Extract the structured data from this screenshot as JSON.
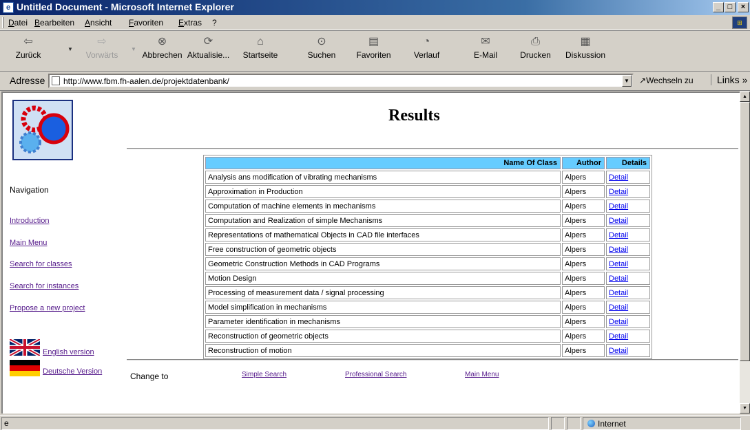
{
  "window": {
    "title": "Untitled Document - Microsoft Internet Explorer"
  },
  "menu": [
    "Datei",
    "Bearbeiten",
    "Ansicht",
    "Favoriten",
    "Extras",
    "?"
  ],
  "toolbar": {
    "back": "Zurück",
    "forward": "Vorwärts",
    "stop": "Abbrechen",
    "refresh": "Aktualisie...",
    "home": "Startseite",
    "search": "Suchen",
    "favorites": "Favoriten",
    "history": "Verlauf",
    "mail": "E-Mail",
    "print": "Drucken",
    "discuss": "Diskussion"
  },
  "address": {
    "label": "Adresse",
    "url": "http://www.fbm.fh-aalen.de/projektdatenbank/",
    "go": "Wechseln zu",
    "links": "Links »"
  },
  "page": {
    "title": "Results",
    "nav_heading": "Navigation",
    "nav": [
      "Introduction",
      "Main Menu",
      "Search for classes",
      "Search for instances",
      "Propose a new project"
    ],
    "english": "English version",
    "deutsch": "Deutsche Version",
    "change_to": "Change to",
    "footer_links": [
      "Simple Search",
      "Professional Search",
      "Main Menu"
    ]
  },
  "table": {
    "headers": [
      "Name Of Class",
      "Author",
      "Details"
    ],
    "rows": [
      {
        "name": "Analysis ans modification of vibrating mechanisms",
        "author": "Alpers",
        "detail": "Detail"
      },
      {
        "name": "Approximation in Production",
        "author": "Alpers",
        "detail": "Detail"
      },
      {
        "name": "Computation of machine elements in mechanisms",
        "author": "Alpers",
        "detail": "Detail"
      },
      {
        "name": "Computation and Realization of simple Mechanisms",
        "author": "Alpers",
        "detail": "Detail"
      },
      {
        "name": "Representations of mathematical Objects in CAD file interfaces",
        "author": "Alpers",
        "detail": "Detail"
      },
      {
        "name": "Free construction of geometric objects",
        "author": "Alpers",
        "detail": "Detail"
      },
      {
        "name": "Geometric Construction Methods in CAD Programs",
        "author": "Alpers",
        "detail": "Detail"
      },
      {
        "name": "Motion Design",
        "author": "Alpers",
        "detail": "Detail"
      },
      {
        "name": "Processing of measurement data / signal processing",
        "author": "Alpers",
        "detail": "Detail"
      },
      {
        "name": "Model simplification in mechanisms",
        "author": "Alpers",
        "detail": "Detail"
      },
      {
        "name": "Parameter identification in mechanisms",
        "author": "Alpers",
        "detail": "Detail"
      },
      {
        "name": "Reconstruction of geometric objects",
        "author": "Alpers",
        "detail": "Detail"
      },
      {
        "name": "Reconstruction of motion",
        "author": "Alpers",
        "detail": "Detail"
      }
    ]
  },
  "status": {
    "zone": "Internet"
  },
  "colors": {
    "header_bg": "#66ccff",
    "titlebar": "#0a246a"
  }
}
